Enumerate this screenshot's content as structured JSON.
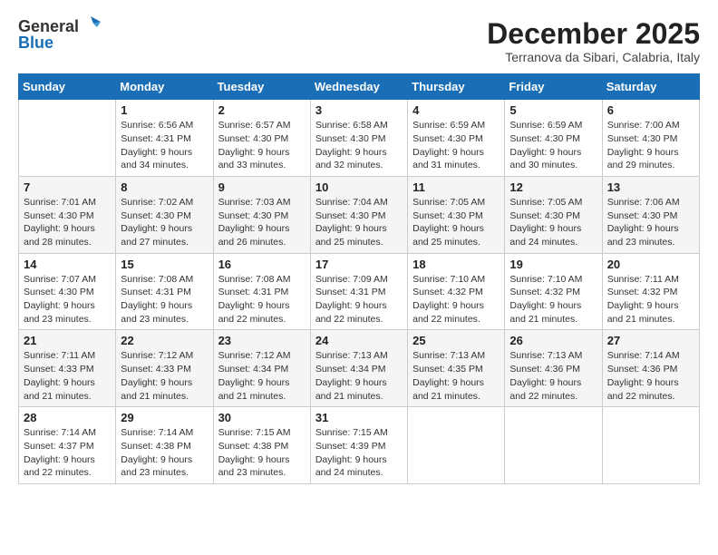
{
  "header": {
    "logo_general": "General",
    "logo_blue": "Blue",
    "month": "December 2025",
    "location": "Terranova da Sibari, Calabria, Italy"
  },
  "weekdays": [
    "Sunday",
    "Monday",
    "Tuesday",
    "Wednesday",
    "Thursday",
    "Friday",
    "Saturday"
  ],
  "weeks": [
    [
      {
        "day": "",
        "info": ""
      },
      {
        "day": "1",
        "info": "Sunrise: 6:56 AM\nSunset: 4:31 PM\nDaylight: 9 hours\nand 34 minutes."
      },
      {
        "day": "2",
        "info": "Sunrise: 6:57 AM\nSunset: 4:30 PM\nDaylight: 9 hours\nand 33 minutes."
      },
      {
        "day": "3",
        "info": "Sunrise: 6:58 AM\nSunset: 4:30 PM\nDaylight: 9 hours\nand 32 minutes."
      },
      {
        "day": "4",
        "info": "Sunrise: 6:59 AM\nSunset: 4:30 PM\nDaylight: 9 hours\nand 31 minutes."
      },
      {
        "day": "5",
        "info": "Sunrise: 6:59 AM\nSunset: 4:30 PM\nDaylight: 9 hours\nand 30 minutes."
      },
      {
        "day": "6",
        "info": "Sunrise: 7:00 AM\nSunset: 4:30 PM\nDaylight: 9 hours\nand 29 minutes."
      }
    ],
    [
      {
        "day": "7",
        "info": "Sunrise: 7:01 AM\nSunset: 4:30 PM\nDaylight: 9 hours\nand 28 minutes."
      },
      {
        "day": "8",
        "info": "Sunrise: 7:02 AM\nSunset: 4:30 PM\nDaylight: 9 hours\nand 27 minutes."
      },
      {
        "day": "9",
        "info": "Sunrise: 7:03 AM\nSunset: 4:30 PM\nDaylight: 9 hours\nand 26 minutes."
      },
      {
        "day": "10",
        "info": "Sunrise: 7:04 AM\nSunset: 4:30 PM\nDaylight: 9 hours\nand 25 minutes."
      },
      {
        "day": "11",
        "info": "Sunrise: 7:05 AM\nSunset: 4:30 PM\nDaylight: 9 hours\nand 25 minutes."
      },
      {
        "day": "12",
        "info": "Sunrise: 7:05 AM\nSunset: 4:30 PM\nDaylight: 9 hours\nand 24 minutes."
      },
      {
        "day": "13",
        "info": "Sunrise: 7:06 AM\nSunset: 4:30 PM\nDaylight: 9 hours\nand 23 minutes."
      }
    ],
    [
      {
        "day": "14",
        "info": "Sunrise: 7:07 AM\nSunset: 4:30 PM\nDaylight: 9 hours\nand 23 minutes."
      },
      {
        "day": "15",
        "info": "Sunrise: 7:08 AM\nSunset: 4:31 PM\nDaylight: 9 hours\nand 23 minutes."
      },
      {
        "day": "16",
        "info": "Sunrise: 7:08 AM\nSunset: 4:31 PM\nDaylight: 9 hours\nand 22 minutes."
      },
      {
        "day": "17",
        "info": "Sunrise: 7:09 AM\nSunset: 4:31 PM\nDaylight: 9 hours\nand 22 minutes."
      },
      {
        "day": "18",
        "info": "Sunrise: 7:10 AM\nSunset: 4:32 PM\nDaylight: 9 hours\nand 22 minutes."
      },
      {
        "day": "19",
        "info": "Sunrise: 7:10 AM\nSunset: 4:32 PM\nDaylight: 9 hours\nand 21 minutes."
      },
      {
        "day": "20",
        "info": "Sunrise: 7:11 AM\nSunset: 4:32 PM\nDaylight: 9 hours\nand 21 minutes."
      }
    ],
    [
      {
        "day": "21",
        "info": "Sunrise: 7:11 AM\nSunset: 4:33 PM\nDaylight: 9 hours\nand 21 minutes."
      },
      {
        "day": "22",
        "info": "Sunrise: 7:12 AM\nSunset: 4:33 PM\nDaylight: 9 hours\nand 21 minutes."
      },
      {
        "day": "23",
        "info": "Sunrise: 7:12 AM\nSunset: 4:34 PM\nDaylight: 9 hours\nand 21 minutes."
      },
      {
        "day": "24",
        "info": "Sunrise: 7:13 AM\nSunset: 4:34 PM\nDaylight: 9 hours\nand 21 minutes."
      },
      {
        "day": "25",
        "info": "Sunrise: 7:13 AM\nSunset: 4:35 PM\nDaylight: 9 hours\nand 21 minutes."
      },
      {
        "day": "26",
        "info": "Sunrise: 7:13 AM\nSunset: 4:36 PM\nDaylight: 9 hours\nand 22 minutes."
      },
      {
        "day": "27",
        "info": "Sunrise: 7:14 AM\nSunset: 4:36 PM\nDaylight: 9 hours\nand 22 minutes."
      }
    ],
    [
      {
        "day": "28",
        "info": "Sunrise: 7:14 AM\nSunset: 4:37 PM\nDaylight: 9 hours\nand 22 minutes."
      },
      {
        "day": "29",
        "info": "Sunrise: 7:14 AM\nSunset: 4:38 PM\nDaylight: 9 hours\nand 23 minutes."
      },
      {
        "day": "30",
        "info": "Sunrise: 7:15 AM\nSunset: 4:38 PM\nDaylight: 9 hours\nand 23 minutes."
      },
      {
        "day": "31",
        "info": "Sunrise: 7:15 AM\nSunset: 4:39 PM\nDaylight: 9 hours\nand 24 minutes."
      },
      {
        "day": "",
        "info": ""
      },
      {
        "day": "",
        "info": ""
      },
      {
        "day": "",
        "info": ""
      }
    ]
  ]
}
